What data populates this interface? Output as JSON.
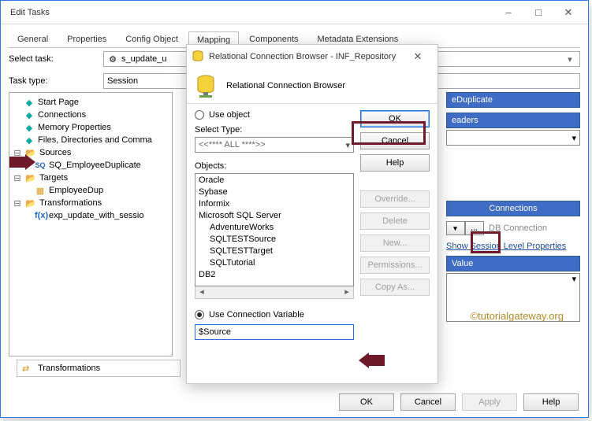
{
  "edit_tasks": {
    "title": "Edit Tasks",
    "tabs": [
      "General",
      "Properties",
      "Config Object",
      "Mapping",
      "Components",
      "Metadata Extensions"
    ],
    "active_tab_index": 3,
    "select_task_label": "Select task:",
    "select_task_value": "s_update_u",
    "task_type_label": "Task type:",
    "task_type_value": "Session",
    "tree": {
      "start_page": "Start Page",
      "connections": "Connections",
      "memory_properties": "Memory Properties",
      "files_dirs": "Files, Directories and Comma",
      "sources": "Sources",
      "sq_employee": "SQ_EmployeeDuplicate",
      "targets": "Targets",
      "employee_dup": "EmployeeDup",
      "transformations": "Transformations",
      "exp_update": "exp_update_with_sessio"
    },
    "lower_tab_label": "Transformations",
    "right": {
      "section_title": "eDuplicate",
      "subsection": "eaders",
      "conn_header": "Connections",
      "conn_row_label": "DB Connection",
      "show_session": "Show Session Level Properties",
      "value_header": "Value"
    },
    "footer": {
      "ok": "OK",
      "cancel": "Cancel",
      "apply": "Apply",
      "help": "Help"
    }
  },
  "dialog": {
    "title": "Relational Connection Browser - INF_Repository",
    "header_text": "Relational Connection Browser",
    "use_object": "Use object",
    "select_type_label": "Select Type:",
    "select_type_value": "<<**** ALL ****>>",
    "objects_label": "Objects:",
    "objects": [
      "Oracle",
      "Sybase",
      "Informix",
      "Microsoft SQL Server",
      "AdventureWorks",
      "SQLTESTSource",
      "SQLTESTTarget",
      "SQLTutorial",
      "DB2"
    ],
    "use_conn_var": "Use Connection Variable",
    "conn_var_value": "$Source",
    "buttons": {
      "ok": "OK",
      "cancel": "Cancel",
      "help": "Help",
      "override": "Override...",
      "delete": "Delete",
      "new": "New...",
      "permissions": "Permissions...",
      "copy_as": "Copy As..."
    }
  },
  "watermark": "©tutorialgateway.org"
}
